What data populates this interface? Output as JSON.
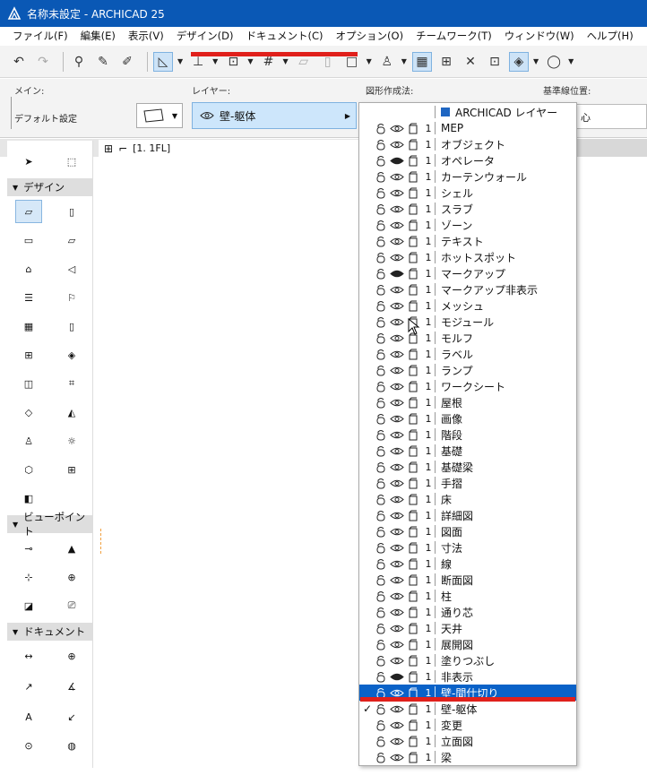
{
  "window": {
    "title": "名称未設定 - ARCHICAD 25"
  },
  "menu": [
    "ファイル(F)",
    "編集(E)",
    "表示(V)",
    "デザイン(D)",
    "ドキュメント(C)",
    "オプション(O)",
    "チームワーク(T)",
    "ウィンドウ(W)",
    "ヘルプ(H)"
  ],
  "infobox": {
    "main_label": "メイン:",
    "layer_label": "レイヤー:",
    "geometry_label": "図形作成法:",
    "ref_label": "基準線位置:",
    "default_settings": "デフォルト設定",
    "layer_value": "壁-躯体",
    "right_cut_text": "心"
  },
  "view_tab": {
    "label": "[1. 1FL]"
  },
  "toolbox": {
    "sections": [
      "デザイン",
      "ビューポイント",
      "ドキュメント"
    ]
  },
  "layers": {
    "group_header": "ARCHICAD レイヤー",
    "number": "1",
    "items": [
      "MEP",
      "オブジェクト",
      "オペレータ",
      "カーテンウォール",
      "シェル",
      "スラブ",
      "ゾーン",
      "テキスト",
      "ホットスポット",
      "マークアップ",
      "マークアップ非表示",
      "メッシュ",
      "モジュール",
      "モルフ",
      "ラベル",
      "ランプ",
      "ワークシート",
      "屋根",
      "画像",
      "階段",
      "基礎",
      "基礎梁",
      "手摺",
      "床",
      "詳細図",
      "図面",
      "寸法",
      "線",
      "断面図",
      "柱",
      "通り芯",
      "天井",
      "展開図",
      "塗りつぶし",
      "非表示",
      "壁-間仕切り",
      "壁-躯体",
      "変更",
      "立面図",
      "梁"
    ],
    "hidden_items": [
      "オペレータ",
      "マークアップ",
      "非表示"
    ],
    "selected": "壁-間仕切り",
    "checked": "壁-躯体"
  },
  "colors": {
    "titlebar": "#0a58b5",
    "selection": "#0a62c8",
    "highlight": "#e0201b"
  }
}
